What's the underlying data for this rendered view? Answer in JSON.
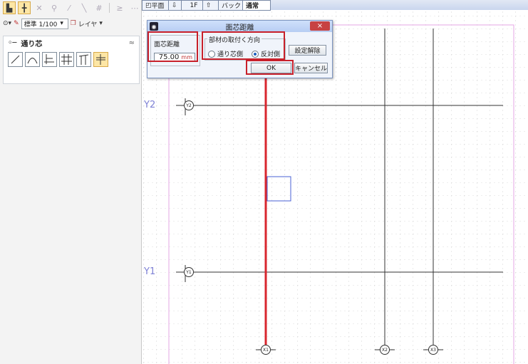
{
  "toolbar": {
    "scale_label": "標準 1/100",
    "layer_label": "レイヤ"
  },
  "subpanel": {
    "title": "通り芯"
  },
  "canvas_tabs": {
    "plan": "平面",
    "floor": "1F",
    "back": "バック",
    "normal": "通常"
  },
  "dialog": {
    "title": "面芯距離",
    "distance_label": "面芯距離",
    "distance_value": "75.00",
    "distance_unit": "mm",
    "direction_group_label": "部材の取付く方向",
    "radio_grid_side": "通り芯側",
    "radio_opposite_side": "反対側",
    "selected_direction": "反対側",
    "clear_button": "設定解除",
    "ok_button": "OK",
    "cancel_button": "キャンセル",
    "close_glyph": "×"
  },
  "grid": {
    "axis_y2": "Y2",
    "axis_y1": "Y1",
    "bubble_y2": "Y2",
    "bubble_y1": "Y1",
    "bubble_x1": "X1",
    "bubble_x2": "X2",
    "bubble_x3": "X3"
  },
  "colors": {
    "highlight": "#c8202a",
    "red_line": "#d8262e",
    "pink_frame": "#e6a7e6",
    "axis_label": "#7f82d6"
  }
}
